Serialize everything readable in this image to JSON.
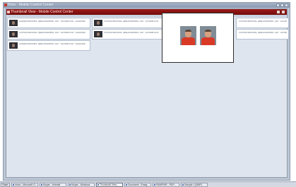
{
  "outer_window": {
    "title": "Pizer · Mobile Control Center"
  },
  "inner_window": {
    "title": "Thumbnail View - Mobile Control Center"
  },
  "results": [
    {
      "text": "GATEWAY/BOOKING: Q86E-WOFAPPIDL: 1107 : 1/27/2008 10:02 · VALIDATED"
    },
    {
      "text": "CUSTODY/BOOKING: Q86E-WOFAPPIDL: 1107 : 1/27/2008 10:02"
    },
    {
      "text": "CUSTODY/BOOKING: Q86E-WOFAPPIDL: 1107 : 1/27/2008 10:02"
    },
    {
      "text": "CUSTODY/BOOKING: Q86E-WOFAPPIDL: 1107 : 1/27/2008 10:03 · VALIDATED"
    },
    {
      "text": "CUSTODY/BOOKING: Q86E-WOFAPPIDL: 1107 : 1/27/2008 10:03"
    },
    {
      "text": "CUSTODY/BOOKING: Q86E-WOFAPPIDL: 1107 : 1/27/2008 10:03"
    }
  ],
  "taskbar": {
    "start_label": "Start",
    "items": [
      {
        "label": "Inbox - Microsoft O...",
        "active": false
      },
      {
        "label": "Mopar - Hotmail",
        "active": false
      },
      {
        "label": "Mopar - Windows",
        "active": false
      },
      {
        "label": "Thumbnail View...",
        "active": true
      },
      {
        "label": "Document - Emag",
        "active": false
      },
      {
        "label": "PAM/PWE - PDF...",
        "active": false
      },
      {
        "label": "Sample 1 (BMP)",
        "active": false
      }
    ]
  }
}
